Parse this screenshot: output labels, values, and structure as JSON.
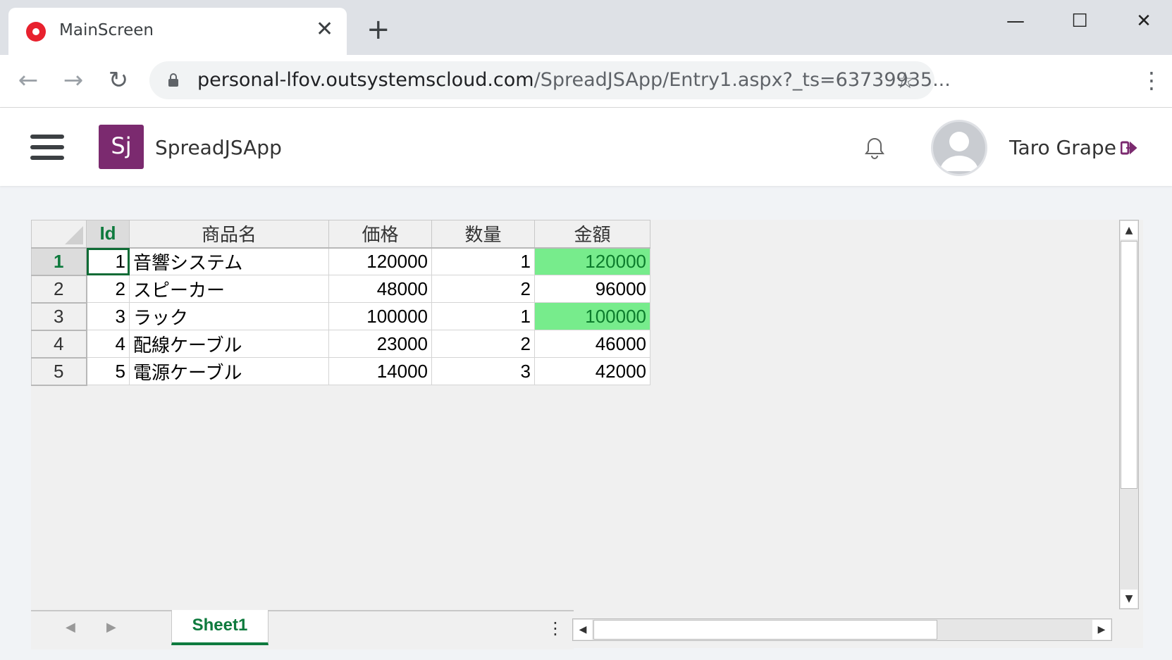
{
  "browser": {
    "tab_title": "MainScreen",
    "tab_close": "✕",
    "new_tab": "+",
    "url_main": "personal-lfov.outsystemscloud.com",
    "url_path": "/SpreadJSApp/Entry1.aspx?_ts=63739935...",
    "icons": [
      "back-arrow-icon",
      "forward-arrow-icon",
      "reload-icon",
      "lock-icon",
      "star-icon",
      "more-vert-icon"
    ]
  },
  "window_controls": {
    "minimize": "—",
    "maximize": "☐",
    "close": "✕"
  },
  "app": {
    "logo_text": "Sj",
    "logo_color": "#7b2a6f",
    "name": "SpreadJSApp",
    "user_name": "Taro Grape",
    "logout_color": "#7b2a6f"
  },
  "sheet": {
    "columns": [
      "Id",
      "商品名",
      "価格",
      "数量",
      "金額"
    ],
    "rows": [
      {
        "header": "1",
        "id": "1",
        "name": "音響システム",
        "price": "120000",
        "qty": "1",
        "amount": "120000",
        "highlight": true
      },
      {
        "header": "2",
        "id": "2",
        "name": "スピーカー",
        "price": "48000",
        "qty": "2",
        "amount": "96000",
        "highlight": false
      },
      {
        "header": "3",
        "id": "3",
        "name": "ラック",
        "price": "100000",
        "qty": "1",
        "amount": "100000",
        "highlight": true
      },
      {
        "header": "4",
        "id": "4",
        "name": "配線ケーブル",
        "price": "23000",
        "qty": "2",
        "amount": "46000",
        "highlight": false
      },
      {
        "header": "5",
        "id": "5",
        "name": "電源ケーブル",
        "price": "14000",
        "qty": "3",
        "amount": "42000",
        "highlight": false
      }
    ],
    "highlight_color": "#77ec8c",
    "sheet_tab": "Sheet1",
    "tab_prev": "◀",
    "tab_next": "▶",
    "tab_menu": "⋮",
    "scroll_up": "▲",
    "scroll_down": "▼",
    "scroll_left": "◀",
    "scroll_right": "▶"
  }
}
